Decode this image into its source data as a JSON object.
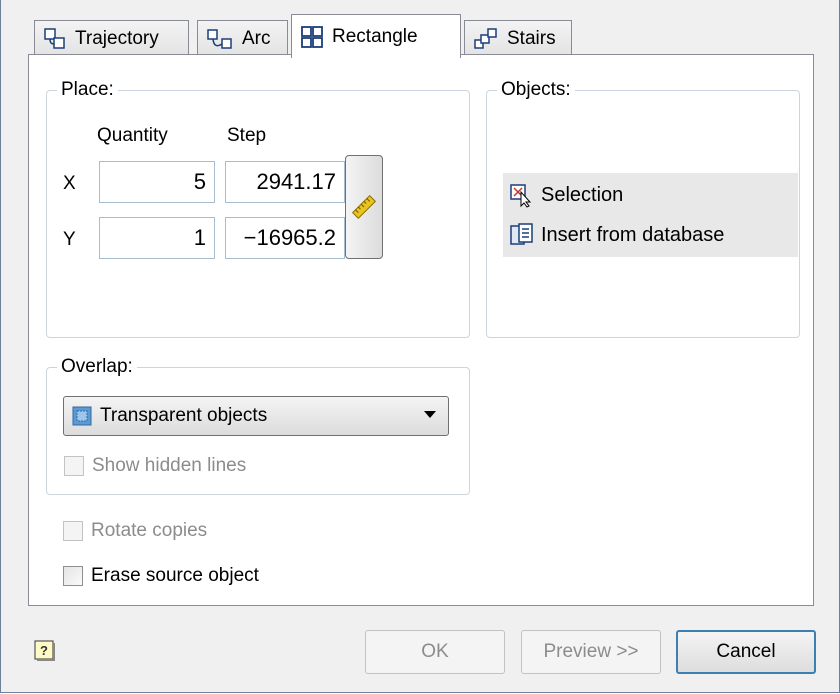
{
  "tabs": [
    {
      "label": "Trajectory",
      "icon": "trajectory-icon"
    },
    {
      "label": "Arc",
      "icon": "arc-icon"
    },
    {
      "label": "Rectangle",
      "icon": "rectangle-grid-icon",
      "active": true
    },
    {
      "label": "Stairs",
      "icon": "stairs-icon"
    }
  ],
  "place": {
    "legend": "Place:",
    "quantity_header": "Quantity",
    "step_header": "Step",
    "x_label": "X",
    "y_label": "Y",
    "x_quantity": "5",
    "y_quantity": "1",
    "x_step": "2941.17",
    "y_step": "−16965.2"
  },
  "objects": {
    "legend": "Objects:",
    "selection_label": "Selection",
    "insert_label": "Insert from database"
  },
  "overlap": {
    "legend": "Overlap:",
    "selected": "Transparent objects",
    "show_hidden_lines": "Show hidden lines"
  },
  "options": {
    "rotate_copies": "Rotate copies",
    "erase_source": "Erase source object"
  },
  "buttons": {
    "ok": "OK",
    "preview": "Preview >>",
    "cancel": "Cancel"
  },
  "colors": {
    "accent": "#3c7fb1",
    "group_border": "#cbd5e0",
    "field_border": "#a9bdd0"
  }
}
